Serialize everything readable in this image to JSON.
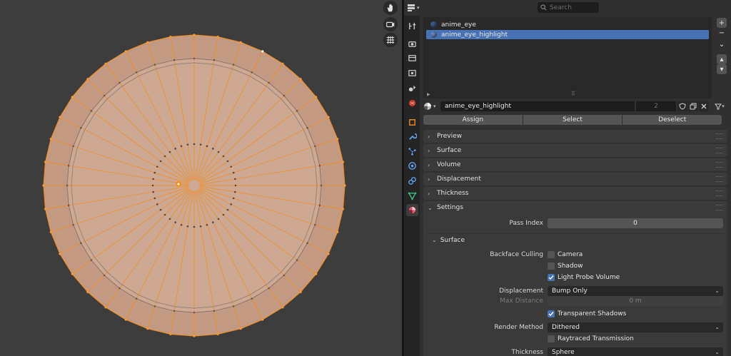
{
  "viewport": {
    "nav_icons": [
      "hand-pan-icon",
      "camera-icon",
      "grid-icon"
    ]
  },
  "header": {
    "search_placeholder": "Search"
  },
  "tabs": [
    "tool-icon",
    "render-icon",
    "output-icon",
    "view-layer-icon",
    "scene-icon",
    "world-icon",
    "object-icon",
    "modifier-icon",
    "particles-icon",
    "physics-icon",
    "constraints-icon",
    "data-icon",
    "material-icon"
  ],
  "material_slots": {
    "items": [
      {
        "name": "anime_eye",
        "selected": false
      },
      {
        "name": "anime_eye_highlight",
        "selected": true
      }
    ]
  },
  "datablock": {
    "name": "anime_eye_highlight",
    "users": "2"
  },
  "assign_row": {
    "assign": "Assign",
    "select": "Select",
    "deselect": "Deselect"
  },
  "panels": {
    "preview": "Preview",
    "surface": "Surface",
    "volume": "Volume",
    "displacement": "Displacement",
    "thickness": "Thickness",
    "settings": "Settings"
  },
  "settings": {
    "pass_index_label": "Pass Index",
    "pass_index_value": "0",
    "surface_sub": "Surface",
    "backface_culling_label": "Backface Culling",
    "camera_label": "Camera",
    "camera_checked": false,
    "shadow_label": "Shadow",
    "shadow_checked": false,
    "light_probe_label": "Light Probe Volume",
    "light_probe_checked": true,
    "displacement_label": "Displacement",
    "displacement_value": "Bump Only",
    "max_distance_label": "Max Distance",
    "max_distance_value": "0 m",
    "transparent_shadows_label": "Transparent Shadows",
    "transparent_shadows_checked": true,
    "render_method_label": "Render Method",
    "render_method_value": "Dithered",
    "raytraced_label": "Raytraced Transmission",
    "raytraced_checked": false,
    "thickness_label": "Thickness",
    "thickness_value": "Sphere"
  },
  "colors": {
    "accent": "#4772b3",
    "mesh_fill": "#c9a38e",
    "mesh_edge": "#f08a24",
    "viewport_bg": "#3d3d3d"
  }
}
